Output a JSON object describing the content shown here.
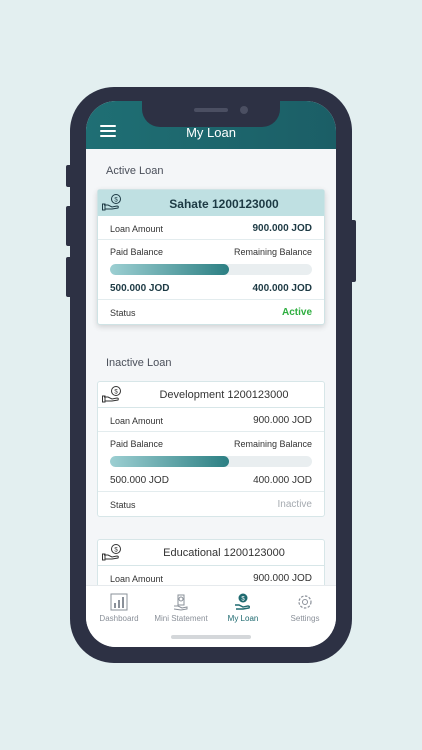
{
  "header": {
    "title": "My Loan",
    "menu_icon": "hamburger-menu-icon"
  },
  "sections": {
    "active_title": "Active Loan",
    "inactive_title": "Inactive Loan"
  },
  "loans": [
    {
      "title": "Sahate 1200123000",
      "loan_amount_label": "Loan Amount",
      "loan_amount": "900.000 JOD",
      "paid_label": "Paid Balance",
      "remaining_label": "Remaining Balance",
      "paid_amount": "500.000 JOD",
      "remaining_amount": "400.000 JOD",
      "paid_fraction": 0.59,
      "status_label": "Status",
      "status": "Active"
    },
    {
      "title": "Development 1200123000",
      "loan_amount_label": "Loan Amount",
      "loan_amount": "900.000 JOD",
      "paid_label": "Paid Balance",
      "remaining_label": "Remaining Balance",
      "paid_amount": "500.000 JOD",
      "remaining_amount": "400.000 JOD",
      "paid_fraction": 0.59,
      "status_label": "Status",
      "status": "Inactive"
    },
    {
      "title": "Educational 1200123000",
      "loan_amount_label": "Loan Amount",
      "loan_amount": "900.000 JOD"
    }
  ],
  "tabs": [
    {
      "label": "Dashboard",
      "icon": "dashboard-icon",
      "selected": false
    },
    {
      "label": "Mini Statement",
      "icon": "mini-statement-icon",
      "selected": false
    },
    {
      "label": "My Loan",
      "icon": "my-loan-icon",
      "selected": true
    },
    {
      "label": "Settings",
      "icon": "settings-icon",
      "selected": false
    }
  ],
  "colors": {
    "accent": "#1f6a70",
    "active_status": "#2eae3f",
    "inactive_status": "#a5aab0",
    "active_header": "#bfe0e2"
  }
}
